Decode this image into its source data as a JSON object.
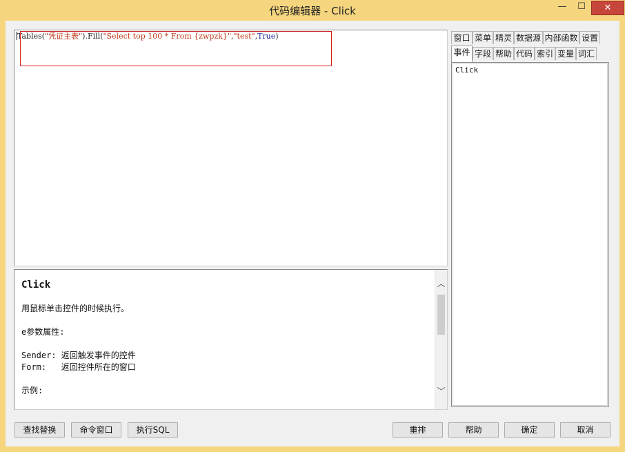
{
  "window": {
    "title": "代码编辑器 - Click",
    "minimize_glyph": "—",
    "maximize_glyph": "☐",
    "close_glyph": "✕"
  },
  "editor": {
    "code_tokens": [
      {
        "text": "Tables(",
        "kind": "plain"
      },
      {
        "text": "\"凭证主表\"",
        "kind": "str"
      },
      {
        "text": ").Fill(",
        "kind": "plain"
      },
      {
        "text": "\"Select top 100 * From {zwpzk}\"",
        "kind": "str"
      },
      {
        "text": ",",
        "kind": "plain"
      },
      {
        "text": "\"test\"",
        "kind": "str"
      },
      {
        "text": ",",
        "kind": "plain"
      },
      {
        "text": "True",
        "kind": "key"
      },
      {
        "text": ")",
        "kind": "plain"
      }
    ]
  },
  "help": {
    "title": "Click",
    "lines": [
      "用鼠标单击控件的时候执行。",
      "",
      "e参数属性:",
      "",
      "Sender: 返回触发事件的控件",
      "Form:   返回控件所在的窗口",
      "",
      "示例:"
    ]
  },
  "tabs": {
    "row1": [
      "窗口",
      "菜单",
      "精灵",
      "数据源",
      "内部函数",
      "设置"
    ],
    "row2": [
      "事件",
      "字段",
      "帮助",
      "代码",
      "索引",
      "变量",
      "词汇"
    ],
    "active": "事件"
  },
  "side_panel": {
    "items": [
      "Click"
    ]
  },
  "buttons": {
    "find_replace": "查找替换",
    "command_window": "命令窗口",
    "execute_sql": "执行SQL",
    "rearrange": "重排",
    "help": "帮助",
    "ok": "确定",
    "cancel": "取消"
  },
  "colors": {
    "title_bar": "#f5d57e",
    "close_button": "#c7463c",
    "string_literal": "#c0391b",
    "keyword": "#1a2a9a",
    "highlight_box": "#d62020"
  }
}
